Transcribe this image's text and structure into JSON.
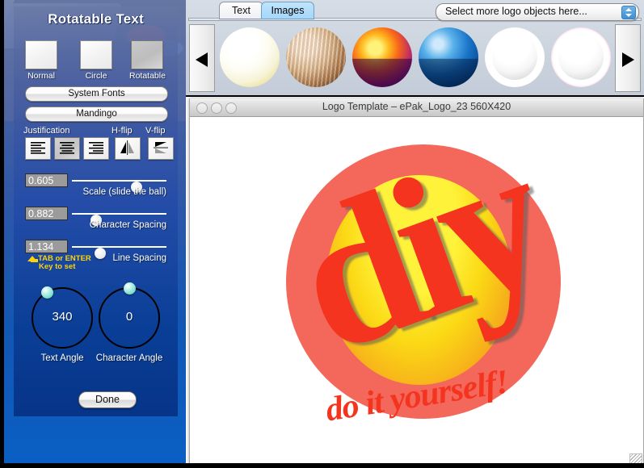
{
  "left_panel": {
    "title": "Rotatable Text",
    "modes": [
      {
        "label": "Normal",
        "selected": false
      },
      {
        "label": "Circle",
        "selected": false
      },
      {
        "label": "Rotatable",
        "selected": true
      }
    ],
    "font_source_button": "System Fonts",
    "font_name_button": "Mandingo",
    "justification_label": "Justification",
    "hflip_label": "H-flip",
    "vflip_label": "V-flip",
    "justification_options": [
      "align-left",
      "align-center",
      "align-right"
    ],
    "justification_selected": "align-center",
    "sliders": [
      {
        "value": "0.605",
        "label": "Scale (slide the ball)",
        "pct": 62
      },
      {
        "value": "0.882",
        "label": "Character Spacing",
        "pct": 20
      },
      {
        "value": "1.134",
        "label": "Line Spacing",
        "pct": 24
      }
    ],
    "hint_line1": "TAB or ENTER",
    "hint_line2": "Key to set",
    "dials": [
      {
        "value": "340",
        "label": "Text Angle",
        "angle": 340
      },
      {
        "value": "0",
        "label": "Character Angle",
        "angle": 0
      }
    ],
    "done_button": "Done"
  },
  "toolbar": {
    "tabs": [
      {
        "label": "Text",
        "active": false
      },
      {
        "label": "Images",
        "active": true
      }
    ],
    "object_select_value": "Select more logo objects here...",
    "prev_arrow": "left-arrow",
    "next_arrow": "right-arrow",
    "thumbnails": [
      {
        "name": "pale-yellow-sphere",
        "style": "sp-pale-yellow"
      },
      {
        "name": "wood-grain-sphere",
        "style": "sp-wood"
      },
      {
        "name": "fire-sunset-sphere",
        "style": "sp-fire"
      },
      {
        "name": "blue-sphere",
        "style": "sp-blue"
      },
      {
        "name": "gold-ring-sphere",
        "style": "sp-ring-gold"
      },
      {
        "name": "pink-ring-sphere",
        "style": "sp-ring-pink"
      }
    ]
  },
  "logo_window": {
    "title": "Logo Template – ePak_Logo_23 560X420",
    "artwork": {
      "main_text": "diy",
      "tagline": "do it yourself!",
      "main_color": "#f4341f",
      "disc_outer_color": "#f4685c",
      "disc_inner_color": "#fbd915"
    }
  }
}
